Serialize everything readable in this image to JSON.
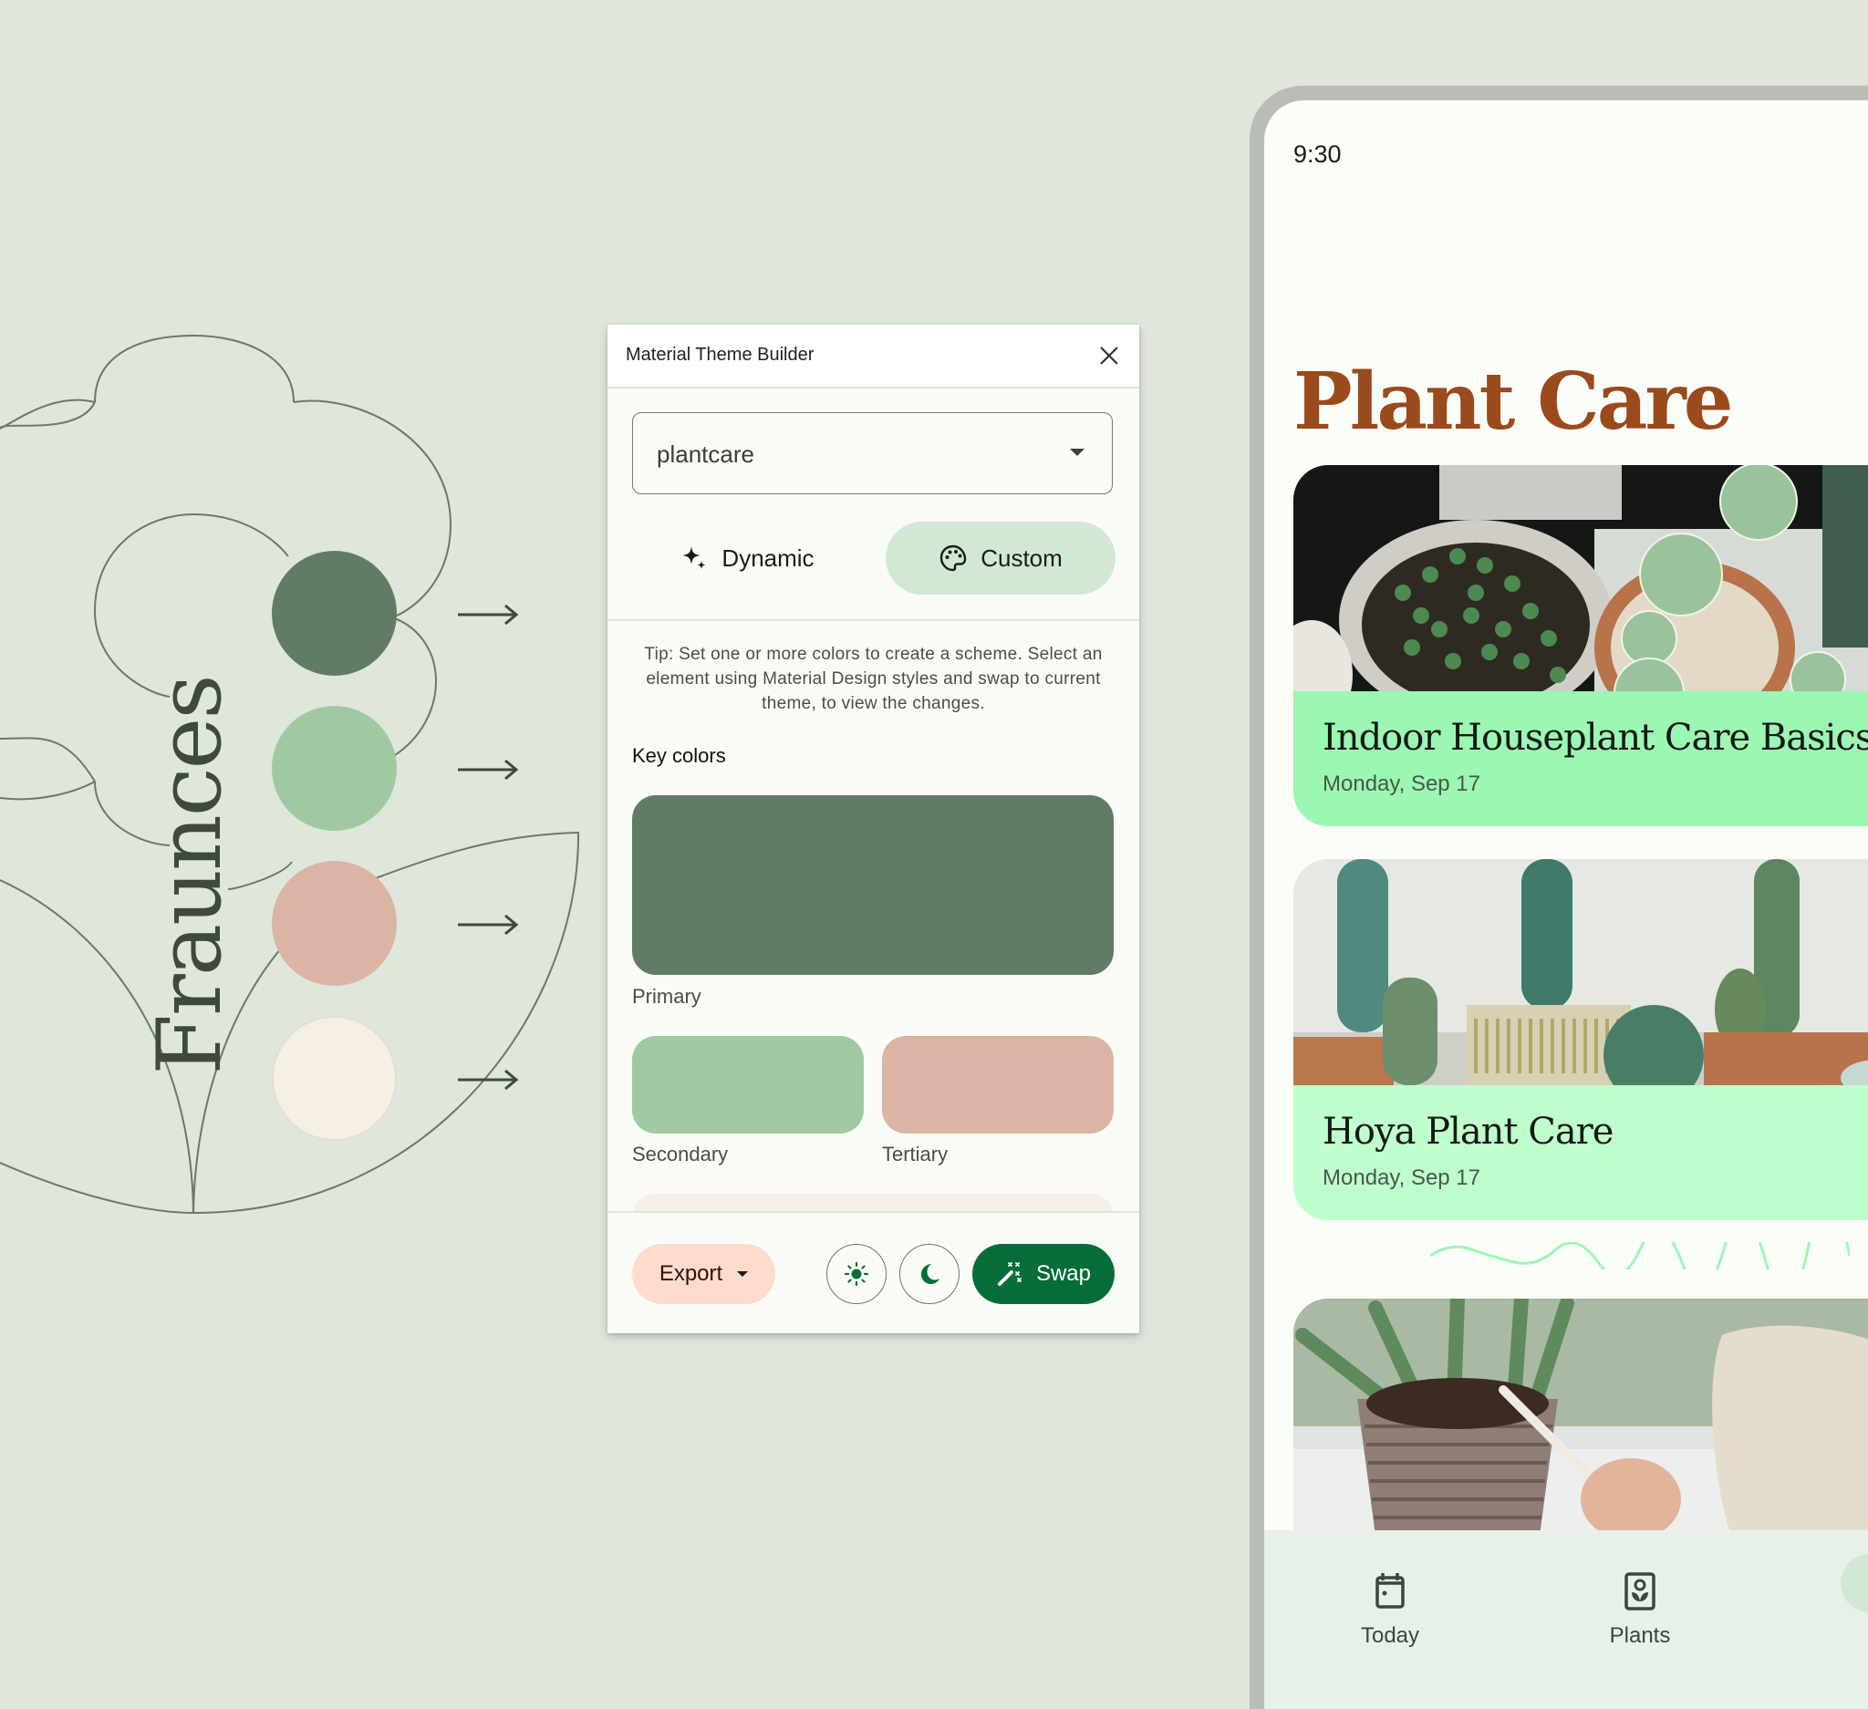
{
  "decoration": {
    "font_name": "Fraunces",
    "palette": [
      {
        "name": "primary",
        "color": "#627b65"
      },
      {
        "name": "secondary",
        "color": "#a1c9a1"
      },
      {
        "name": "tertiary",
        "color": "#dbb4a4"
      },
      {
        "name": "neutral",
        "color": "#f5efe4"
      }
    ]
  },
  "panel": {
    "title": "Material Theme Builder",
    "theme_select": {
      "value": "plantcare"
    },
    "modes": [
      {
        "label": "Dynamic",
        "icon": "sparkle-icon",
        "selected": false
      },
      {
        "label": "Custom",
        "icon": "palette-icon",
        "selected": true
      }
    ],
    "tip": "Tip: Set one or more colors to create a scheme. Select an element using Material Design styles and swap to current theme, to view the changes.",
    "key_colors_title": "Key colors",
    "key_colors": {
      "primary": {
        "label": "Primary",
        "color": "#627b65"
      },
      "secondary": {
        "label": "Secondary",
        "color": "#a1c9a1"
      },
      "tertiary": {
        "label": "Tertiary",
        "color": "#dbb4a4"
      },
      "neutral": {
        "label": "",
        "color": "#f5efe4"
      }
    },
    "footer": {
      "export_label": "Export",
      "swap_label": "Swap",
      "light_mode": "sun-icon",
      "dark_mode": "moon-icon"
    },
    "colors": {
      "accent": "#076d38",
      "export_bg": "#ffdbcc",
      "selected_mode_bg": "#d1e8d5"
    }
  },
  "device": {
    "clock": "9:30",
    "app_title": "Plant Care",
    "title_color": "#9b4a1c",
    "cards": [
      {
        "title": "Indoor Houseplant Care Basics",
        "date": "Monday, Sep 17",
        "band_color": "#9cf6b4",
        "image": "string-of-pearls-plants-photo"
      },
      {
        "title": "Hoya Plant Care",
        "date": "Monday, Sep 17",
        "band_color": "#bfffcd",
        "image": "cactus-pots-photo"
      },
      {
        "title": "",
        "date": "",
        "image": "watering-plant-photo"
      }
    ],
    "nav": [
      {
        "label": "Today",
        "icon": "calendar-icon"
      },
      {
        "label": "Plants",
        "icon": "plant-frame-icon"
      }
    ]
  }
}
